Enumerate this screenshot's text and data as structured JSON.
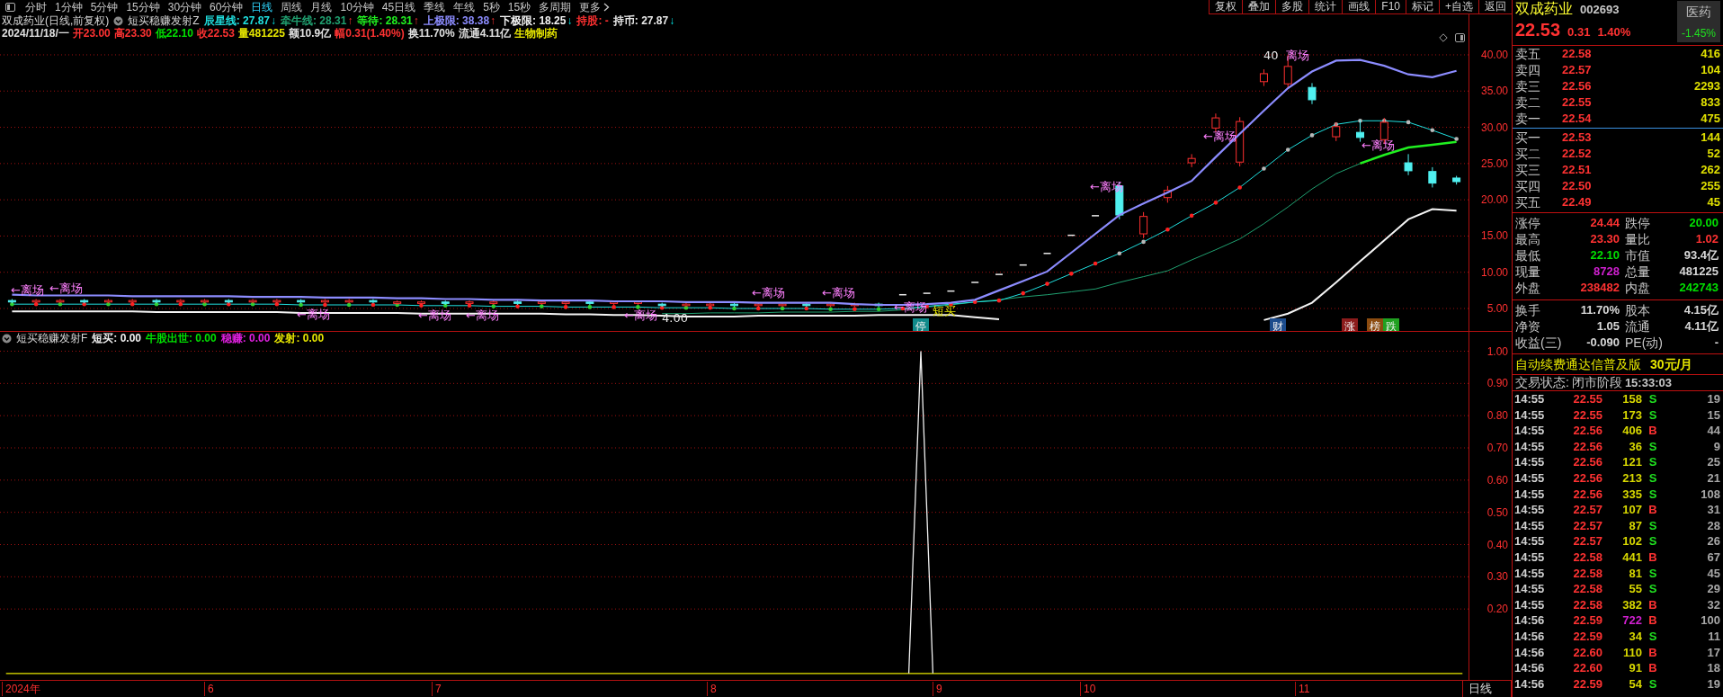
{
  "menu": {
    "periods": [
      {
        "label": "分时",
        "selected": false
      },
      {
        "label": "1分钟",
        "selected": false
      },
      {
        "label": "5分钟",
        "selected": false
      },
      {
        "label": "15分钟",
        "selected": false
      },
      {
        "label": "30分钟",
        "selected": false
      },
      {
        "label": "60分钟",
        "selected": false
      },
      {
        "label": "日线",
        "selected": true
      },
      {
        "label": "周线",
        "selected": false
      },
      {
        "label": "月线",
        "selected": false
      },
      {
        "label": "10分钟",
        "selected": false
      },
      {
        "label": "45日线",
        "selected": false
      },
      {
        "label": "季线",
        "selected": false
      },
      {
        "label": "年线",
        "selected": false
      },
      {
        "label": "5秒",
        "selected": false
      },
      {
        "label": "15秒",
        "selected": false
      },
      {
        "label": "多周期",
        "selected": false
      }
    ],
    "more": "更多",
    "tools": [
      "复权",
      "叠加",
      "多股",
      "统计",
      "画线",
      "F10",
      "标记",
      "+自选",
      "返回"
    ]
  },
  "chart": {
    "title": "双成药业(日线,前复权)",
    "indicator": "短买稳赚发射Z",
    "separator": ":",
    "lines": [
      {
        "value": "27.87",
        "arrow": "↓",
        "rising": false
      },
      {
        "value": "28.31",
        "arrow": "↑",
        "rising": true
      },
      {
        "value": "28.31",
        "arrow": "↑",
        "rising": true
      },
      {
        "value": "38.38",
        "arrow": "↑",
        "rising": true
      },
      {
        "value": "18.25",
        "arrow": "↓",
        "rising": false
      }
    ],
    "status": [
      {
        "label": "持股",
        "value": "-",
        "color": "#ff3030"
      },
      {
        "label": "持币",
        "value": "27.87",
        "arrow": "↓",
        "rising": false,
        "color": "#e8e8e8"
      }
    ],
    "quote": [
      {
        "text": "2024/11/18/一",
        "color": "#e0e0e0"
      },
      {
        "text": "开23.00",
        "color": "#ff3232"
      },
      {
        "text": "高23.30",
        "color": "#ff3232"
      },
      {
        "text": "低22.10",
        "color": "#00e000"
      },
      {
        "text": "收22.53",
        "color": "#ff3232"
      },
      {
        "text": "量481225",
        "color": "#e8e800"
      },
      {
        "text": "额10.9亿",
        "color": "#e0e0e0"
      },
      {
        "text": "幅0.31(1.40%)",
        "color": "#ff3232"
      },
      {
        "text": "换11.70%",
        "color": "#e0e0e0"
      },
      {
        "text": "流通4.11亿",
        "color": "#e0e0e0"
      },
      {
        "text": "生物制药",
        "color": "#e8e800"
      }
    ],
    "chart_data": {
      "type": "candlestick",
      "grid": true,
      "ylim": [
        1.9,
        45.58
      ],
      "yticks": [
        {
          "value": 40,
          "label": "40.00"
        },
        {
          "value": 35,
          "label": "35.00"
        },
        {
          "value": 30,
          "label": "30.00"
        },
        {
          "value": 25,
          "label": "25.00"
        },
        {
          "value": 20,
          "label": "20.00"
        },
        {
          "value": 15,
          "label": "15.00"
        },
        {
          "value": 10,
          "label": "10.00"
        },
        {
          "value": 5,
          "label": "5.00"
        }
      ],
      "categories": [
        null,
        null,
        null,
        null,
        null,
        null,
        null,
        null,
        null,
        null,
        null,
        null,
        null,
        null,
        null,
        null,
        null,
        null,
        null,
        null,
        null,
        null,
        null,
        null,
        null,
        null,
        null,
        null,
        null,
        null,
        null,
        null,
        null,
        null,
        null,
        null,
        null,
        null,
        null,
        null,
        null,
        null,
        null,
        null,
        null,
        null,
        null,
        null,
        null,
        null,
        null,
        null,
        null,
        null,
        null,
        null,
        null,
        null,
        null,
        null,
        null
      ],
      "ohlc": [
        [
          6.1,
          6.3,
          5.7,
          5.9
        ],
        [
          5.9,
          6.3,
          5.7,
          6.1
        ],
        [
          5.9,
          6.3,
          5.7,
          6.1
        ],
        [
          6.1,
          6.3,
          5.7,
          5.9
        ],
        [
          5.9,
          6.3,
          5.7,
          6.1
        ],
        [
          5.9,
          6.3,
          5.7,
          6.1
        ],
        [
          6.1,
          6.3,
          5.7,
          5.9
        ],
        [
          5.9,
          6.3,
          5.7,
          6.1
        ],
        [
          5.9,
          6.3,
          5.7,
          6.1
        ],
        [
          6.1,
          6.3,
          5.7,
          5.9
        ],
        [
          5.9,
          6.3,
          5.7,
          6.1
        ],
        [
          5.9,
          6.3,
          5.7,
          6.1
        ],
        [
          6.1,
          6.3,
          5.7,
          5.9
        ],
        [
          5.9,
          6.3,
          5.7,
          6.1
        ],
        [
          5.9,
          6.3,
          5.7,
          6.1
        ],
        [
          6.1,
          6.3,
          5.7,
          5.9
        ],
        [
          5.7,
          6.1,
          5.5,
          5.9
        ],
        [
          5.7,
          6.1,
          5.5,
          5.9
        ],
        [
          5.9,
          6.1,
          5.5,
          5.7
        ],
        [
          5.7,
          6.1,
          5.5,
          5.9
        ],
        [
          5.7,
          6.1,
          5.5,
          5.9
        ],
        [
          5.9,
          6.1,
          5.5,
          5.7
        ],
        [
          5.7,
          6.1,
          5.5,
          5.9
        ],
        [
          5.7,
          6.1,
          5.5,
          5.9
        ],
        [
          5.9,
          6.1,
          5.5,
          5.7
        ],
        [
          5.7,
          6.1,
          5.5,
          5.9
        ],
        [
          5.7,
          6.1,
          5.5,
          5.9
        ],
        [
          5.6,
          5.8,
          5.2,
          5.4
        ],
        [
          5.4,
          5.8,
          5.2,
          5.6
        ],
        [
          5.4,
          5.8,
          5.2,
          5.6
        ],
        [
          5.6,
          5.8,
          5.2,
          5.4
        ],
        [
          5.4,
          5.8,
          5.2,
          5.6
        ],
        [
          5.4,
          5.8,
          5.2,
          5.6
        ],
        [
          5.6,
          5.8,
          5.2,
          5.4
        ],
        [
          5.4,
          5.8,
          5.2,
          5.6
        ],
        [
          5.4,
          5.8,
          5.2,
          5.6
        ],
        [
          5.6,
          5.8,
          5.2,
          5.4
        ],
        [
          6.9,
          6.9,
          6.9,
          6.9
        ],
        [
          7.1,
          7.1,
          7.1,
          7.1
        ],
        [
          7.4,
          7.4,
          7.4,
          7.4
        ],
        [
          8.6,
          8.6,
          8.6,
          8.6
        ],
        [
          9.7,
          9.7,
          9.7,
          9.7
        ],
        [
          11.0,
          11.0,
          11.0,
          11.0
        ],
        [
          12.6,
          12.6,
          12.6,
          12.6
        ],
        [
          15.1,
          15.1,
          15.1,
          15.1
        ],
        [
          17.8,
          17.8,
          17.8,
          17.8
        ],
        [
          21.9,
          22.5,
          17.3,
          17.9
        ],
        [
          15.3,
          18.3,
          14.7,
          17.7
        ],
        [
          20.3,
          21.9,
          19.6,
          21.3
        ],
        [
          25.1,
          26.3,
          24.5,
          25.7
        ],
        [
          29.9,
          31.9,
          29.3,
          31.3
        ],
        [
          25.2,
          31.4,
          24.6,
          30.8
        ],
        [
          36.3,
          38.0,
          35.7,
          37.4
        ],
        [
          36.0,
          40.0,
          35.4,
          38.4
        ],
        [
          35.5,
          36.1,
          33.2,
          33.8
        ],
        [
          28.7,
          30.7,
          28.1,
          30.1
        ],
        [
          29.3,
          31.0,
          28.0,
          28.6
        ],
        [
          28.3,
          31.3,
          27.7,
          30.7
        ],
        [
          25.1,
          26.3,
          23.4,
          24.0
        ],
        [
          23.9,
          24.5,
          21.7,
          22.3
        ],
        [
          23.0,
          23.3,
          22.1,
          22.5
        ]
      ],
      "series": [
        {
          "name": "辰星线",
          "type": "line",
          "color": "#20e0e0",
          "values": [
            5.6,
            5.6,
            5.6,
            5.6,
            5.6,
            5.6,
            5.6,
            5.6,
            5.6,
            5.6,
            5.6,
            5.6,
            5.5,
            5.5,
            5.5,
            5.5,
            5.5,
            5.4,
            5.4,
            5.4,
            5.3,
            5.3,
            5.3,
            5.2,
            5.2,
            5.2,
            5.2,
            5.1,
            5.1,
            5.1,
            5.0,
            5.0,
            5.0,
            5.0,
            4.9,
            4.9,
            4.9,
            5.0,
            5.3,
            5.6,
            5.9,
            6.1,
            7.1,
            8.4,
            9.8,
            11.2,
            12.6,
            14.2,
            15.9,
            17.8,
            19.6,
            21.7,
            24.3,
            26.9,
            28.9,
            30.4,
            30.9,
            30.9,
            30.7,
            29.6,
            28.4
          ]
        },
        {
          "name": "牵牛线",
          "type": "line",
          "color": "#20a070",
          "values": [
            null,
            null,
            null,
            null,
            null,
            null,
            null,
            null,
            null,
            null,
            null,
            null,
            null,
            null,
            null,
            null,
            null,
            null,
            null,
            null,
            null,
            null,
            null,
            null,
            null,
            null,
            null,
            4.3,
            4.3,
            4.4,
            4.4,
            4.4,
            4.5,
            4.5,
            4.5,
            4.6,
            4.6,
            4.8,
            5.2,
            5.5,
            5.9,
            6.2,
            6.6,
            6.9,
            7.3,
            7.7,
            8.6,
            9.4,
            10.2,
            11.7,
            13.1,
            14.6,
            16.7,
            19.0,
            21.5,
            23.6,
            25.0,
            null,
            null,
            null,
            null
          ]
        },
        {
          "name": "等待",
          "type": "line",
          "color": "#20f020",
          "values": [
            null,
            null,
            null,
            null,
            null,
            null,
            null,
            null,
            null,
            null,
            null,
            null,
            null,
            null,
            null,
            null,
            null,
            null,
            null,
            null,
            null,
            null,
            null,
            null,
            null,
            null,
            null,
            null,
            null,
            null,
            null,
            null,
            null,
            null,
            null,
            null,
            null,
            null,
            null,
            null,
            null,
            null,
            null,
            null,
            null,
            null,
            null,
            null,
            null,
            null,
            null,
            null,
            null,
            null,
            null,
            null,
            25.0,
            26.2,
            27.2,
            27.6,
            28.0
          ]
        },
        {
          "name": "上极限",
          "type": "line",
          "color": "#8c8cff",
          "values": [
            6.9,
            6.8,
            6.8,
            6.8,
            6.8,
            6.7,
            6.7,
            6.7,
            6.7,
            6.7,
            6.6,
            6.6,
            6.6,
            6.5,
            6.5,
            6.5,
            6.4,
            6.4,
            6.3,
            6.3,
            6.2,
            6.2,
            6.1,
            6.1,
            6.1,
            6.0,
            6.0,
            6.0,
            5.9,
            5.9,
            5.9,
            5.8,
            5.8,
            5.8,
            5.8,
            5.6,
            5.5,
            5.5,
            5.6,
            5.8,
            6.2,
            7.5,
            8.8,
            10.1,
            12.7,
            15.3,
            17.9,
            19.5,
            21.0,
            22.6,
            25.9,
            29.1,
            32.3,
            35.4,
            37.7,
            39.2,
            39.3,
            38.5,
            37.3,
            36.9,
            37.8
          ]
        },
        {
          "name": "下极限",
          "type": "line",
          "color": "#f4f4f4",
          "values": [
            4.6,
            4.6,
            4.6,
            4.6,
            4.6,
            4.6,
            4.5,
            4.5,
            4.5,
            4.5,
            4.5,
            4.5,
            4.4,
            4.4,
            4.4,
            4.4,
            4.4,
            4.3,
            4.3,
            4.3,
            4.3,
            4.3,
            4.3,
            4.2,
            4.2,
            4.1,
            4.1,
            4.0,
            3.9,
            3.9,
            3.9,
            4.0,
            4.0,
            4.0,
            4.0,
            4.0,
            4.1,
            4.1,
            4.1,
            4.1,
            3.8,
            3.5,
            null,
            null,
            null,
            null,
            null,
            null,
            null,
            null,
            null,
            null,
            3.4,
            4.3,
            5.8,
            8.6,
            11.5,
            14.4,
            17.3,
            18.7,
            18.5
          ]
        }
      ]
    },
    "labels": [
      {
        "text": "←离场",
        "kind": "exit"
      },
      {
        "text": "←离场",
        "kind": "exit"
      },
      {
        "text": "←离场",
        "kind": "exit"
      },
      {
        "text": "←离场",
        "kind": "exit"
      },
      {
        "text": "←离场",
        "kind": "exit"
      },
      {
        "text": "←离场",
        "kind": "exit"
      },
      {
        "text": "←离场",
        "kind": "exit"
      },
      {
        "text": "←离场",
        "kind": "exit"
      },
      {
        "text": "←离场",
        "kind": "exit"
      },
      {
        "text": "短买",
        "kind": "buy"
      },
      {
        "text": "4.00",
        "kind": "price"
      },
      {
        "text": "←离场",
        "kind": "exit"
      },
      {
        "text": "←离场",
        "kind": "exit"
      },
      {
        "text": "40",
        "kind": "price"
      },
      {
        "text": "离场",
        "kind": "exit"
      },
      {
        "text": "←离场",
        "kind": "exit"
      },
      {
        "text": "停",
        "kind": "badge",
        "color": "#108a8a"
      },
      {
        "text": "财",
        "kind": "badge",
        "color": "#1c4c8c"
      },
      {
        "text": "涨",
        "kind": "badge",
        "color": "#8c1c1c"
      },
      {
        "text": "榜",
        "kind": "badge",
        "color": "#8c4c10"
      },
      {
        "text": "跌",
        "kind": "badge",
        "color": "#20a020"
      }
    ]
  },
  "indicator_panel": {
    "indicator": "短买稳赚发射F",
    "separator": ":",
    "values": [
      {
        "kind": "series",
        "value": "0.00"
      },
      {
        "kind": "plain",
        "label": "牛股出世",
        "color": "#00e000",
        "value": "0.00"
      },
      {
        "kind": "plain",
        "label": "稳赚",
        "color": "#e020e0",
        "value": "0.00"
      },
      {
        "kind": "series",
        "value": "0.00"
      }
    ],
    "chart_data": {
      "type": "line",
      "grid": true,
      "ylim": [
        -0.02,
        1.06
      ],
      "yticks": [
        {
          "value": 1,
          "label": "1.00"
        },
        {
          "value": 0.9,
          "label": "0.90"
        },
        {
          "value": 0.8,
          "label": "0.80"
        },
        {
          "value": 0.7,
          "label": "0.70"
        },
        {
          "value": 0.6,
          "label": "0.60"
        },
        {
          "value": 0.5,
          "label": "0.50"
        },
        {
          "value": 0.4,
          "label": "0.40"
        },
        {
          "value": 0.3,
          "label": "0.30"
        },
        {
          "value": 0.2,
          "label": "0.20"
        }
      ],
      "categories": [
        null,
        null,
        null,
        null,
        null,
        null,
        null,
        null,
        null,
        null,
        null,
        null,
        null,
        null,
        null,
        null,
        null,
        null,
        null,
        null,
        null,
        null,
        null,
        null,
        null,
        null,
        null,
        null,
        null,
        null,
        null,
        null,
        null,
        null,
        null,
        null,
        null,
        null,
        null,
        null,
        null,
        null,
        null,
        null,
        null,
        null,
        null,
        null,
        null,
        null,
        null,
        null,
        null,
        null,
        null,
        null,
        null,
        null,
        null,
        null,
        null,
        null,
        null,
        null,
        null,
        null,
        null,
        null,
        null,
        null,
        null,
        null,
        null,
        null,
        null,
        null,
        null,
        null,
        null,
        null,
        null,
        null,
        null,
        null,
        null,
        null,
        null,
        null,
        null,
        null,
        null,
        null,
        null,
        null,
        null,
        null,
        null,
        null,
        null,
        null,
        null,
        null,
        null,
        null,
        null,
        null,
        null,
        null,
        null,
        null,
        null,
        null,
        null,
        null,
        null,
        null,
        null,
        null,
        null,
        null,
        null,
        null
      ],
      "series": [
        {
          "name": "短买",
          "color": "#f0f0f0",
          "values": [
            null,
            null,
            null,
            null,
            null,
            null,
            null,
            null,
            null,
            null,
            null,
            null,
            null,
            null,
            null,
            null,
            null,
            null,
            null,
            null,
            null,
            null,
            null,
            null,
            null,
            null,
            null,
            null,
            null,
            null,
            null,
            null,
            null,
            null,
            null,
            null,
            null,
            null,
            null,
            null,
            null,
            null,
            null,
            null,
            null,
            null,
            null,
            null,
            null,
            null,
            null,
            null,
            null,
            null,
            null,
            null,
            null,
            null,
            null,
            null,
            null,
            null,
            null,
            null,
            null,
            null,
            null,
            null,
            null,
            null,
            null,
            null,
            null,
            null,
            null,
            0,
            1,
            0,
            null,
            null,
            null,
            null,
            null,
            null,
            null,
            null,
            null,
            null,
            null,
            null,
            null,
            null,
            null,
            null,
            null,
            null,
            null,
            null,
            null,
            null,
            null,
            null,
            null,
            null,
            null,
            null,
            null,
            null,
            null,
            null,
            null,
            null,
            null,
            null,
            null,
            null,
            null,
            null,
            null,
            null,
            null,
            null
          ]
        },
        {
          "name": "发射",
          "color": "#e8e800",
          "values": [
            0,
            0,
            0,
            0,
            0,
            0,
            0,
            0,
            0,
            0,
            0,
            0,
            0,
            0,
            0,
            0,
            0,
            0,
            0,
            0,
            0,
            0,
            0,
            0,
            0,
            0,
            0,
            0,
            0,
            0,
            0,
            0,
            0,
            0,
            0,
            0,
            0,
            0,
            0,
            0,
            0,
            0,
            0,
            0,
            0,
            0,
            0,
            0,
            0,
            0,
            0,
            0,
            0,
            0,
            0,
            0,
            0,
            0,
            0,
            0,
            0,
            0,
            0,
            0,
            0,
            0,
            0,
            0,
            0,
            0,
            0,
            0,
            0,
            0,
            0,
            0,
            0,
            0,
            0,
            0,
            0,
            0,
            0,
            0,
            0,
            0,
            0,
            0,
            0,
            0,
            0,
            0,
            0,
            0,
            0,
            0,
            0,
            0,
            0,
            0,
            0,
            0,
            0,
            0,
            0,
            0,
            0,
            0,
            0,
            0,
            0,
            0,
            0,
            0,
            0,
            0,
            0,
            0,
            0,
            0,
            0,
            0
          ]
        }
      ]
    }
  },
  "x_axis": {
    "labels": [
      "2024年",
      "6",
      "7",
      "8",
      "9",
      "10",
      "11"
    ],
    "period": "日线"
  },
  "quote_panel": {
    "name": "双成药业",
    "code": "002693",
    "price": "22.53",
    "change": "0.31",
    "change_pct": "1.40%",
    "sector": {
      "name": "医药",
      "change": "-1.45%"
    },
    "asks": [
      {
        "label": "卖五",
        "price": "22.58",
        "volume": "416"
      },
      {
        "label": "卖四",
        "price": "22.57",
        "volume": "104"
      },
      {
        "label": "卖三",
        "price": "22.56",
        "volume": "2293"
      },
      {
        "label": "卖二",
        "price": "22.55",
        "volume": "833"
      },
      {
        "label": "卖一",
        "price": "22.54",
        "volume": "475"
      }
    ],
    "bids": [
      {
        "label": "买一",
        "price": "22.53",
        "volume": "144"
      },
      {
        "label": "买二",
        "price": "22.52",
        "volume": "52"
      },
      {
        "label": "买三",
        "price": "22.51",
        "volume": "262"
      },
      {
        "label": "买四",
        "price": "22.50",
        "volume": "255"
      },
      {
        "label": "买五",
        "price": "22.49",
        "volume": "45"
      }
    ],
    "stats": [
      {
        "label": "涨停",
        "value": "24.44",
        "color": "#ff3232"
      },
      {
        "label": "跌停",
        "value": "20.00",
        "color": "#00e000"
      },
      {
        "label": "最高",
        "value": "23.30",
        "color": "#ff3232"
      },
      {
        "label": "量比",
        "value": "1.02",
        "color": "#ff3232"
      },
      {
        "label": "最低",
        "value": "22.10",
        "color": "#00e000"
      },
      {
        "label": "市值",
        "value": "93.4亿",
        "color": "#d8d8d8"
      },
      {
        "label": "现量",
        "value": "8728",
        "color": "#d020d0"
      },
      {
        "label": "总量",
        "value": "481225",
        "color": "#d8d8d8"
      },
      {
        "label": "外盘",
        "value": "238482",
        "color": "#ff3232"
      },
      {
        "label": "内盘",
        "value": "242743",
        "color": "#00e000"
      }
    ],
    "fundamentals": [
      {
        "label": "换手",
        "value": "11.70%"
      },
      {
        "label": "股本",
        "value": "4.15亿"
      },
      {
        "label": "净资",
        "value": "1.05"
      },
      {
        "label": "流通",
        "value": "4.11亿"
      },
      {
        "label": "收益(三)",
        "value": "-0.090"
      },
      {
        "label": "PE(动)",
        "value": "-"
      }
    ],
    "promo": {
      "text": "自动续费通达信普及版",
      "price": "30元/月"
    },
    "trade_status": {
      "label": "交易状态:",
      "value": "闭市阶段",
      "time": "15:33:03"
    },
    "ticks": [
      {
        "time": "14:55",
        "price": "22.55",
        "volume": "158",
        "side": "S",
        "buy": false,
        "big": false,
        "count": "19"
      },
      {
        "time": "14:55",
        "price": "22.55",
        "volume": "173",
        "side": "S",
        "buy": false,
        "big": false,
        "count": "15"
      },
      {
        "time": "14:55",
        "price": "22.56",
        "volume": "406",
        "side": "B",
        "buy": true,
        "big": false,
        "count": "44"
      },
      {
        "time": "14:55",
        "price": "22.56",
        "volume": "36",
        "side": "S",
        "buy": false,
        "big": false,
        "count": "9"
      },
      {
        "time": "14:55",
        "price": "22.56",
        "volume": "121",
        "side": "S",
        "buy": false,
        "big": false,
        "count": "25"
      },
      {
        "time": "14:55",
        "price": "22.56",
        "volume": "213",
        "side": "S",
        "buy": false,
        "big": false,
        "count": "21"
      },
      {
        "time": "14:55",
        "price": "22.56",
        "volume": "335",
        "side": "S",
        "buy": false,
        "big": false,
        "count": "108"
      },
      {
        "time": "14:55",
        "price": "22.57",
        "volume": "107",
        "side": "B",
        "buy": true,
        "big": false,
        "count": "31"
      },
      {
        "time": "14:55",
        "price": "22.57",
        "volume": "87",
        "side": "S",
        "buy": false,
        "big": false,
        "count": "28"
      },
      {
        "time": "14:55",
        "price": "22.57",
        "volume": "102",
        "side": "S",
        "buy": false,
        "big": false,
        "count": "26"
      },
      {
        "time": "14:55",
        "price": "22.58",
        "volume": "441",
        "side": "B",
        "buy": true,
        "big": false,
        "count": "67"
      },
      {
        "time": "14:55",
        "price": "22.58",
        "volume": "81",
        "side": "S",
        "buy": false,
        "big": false,
        "count": "45"
      },
      {
        "time": "14:55",
        "price": "22.58",
        "volume": "55",
        "side": "S",
        "buy": false,
        "big": false,
        "count": "29"
      },
      {
        "time": "14:55",
        "price": "22.58",
        "volume": "382",
        "side": "B",
        "buy": true,
        "big": false,
        "count": "32"
      },
      {
        "time": "14:56",
        "price": "22.59",
        "volume": "722",
        "side": "B",
        "buy": true,
        "big": true,
        "count": "100"
      },
      {
        "time": "14:56",
        "price": "22.59",
        "volume": "34",
        "side": "S",
        "buy": false,
        "big": false,
        "count": "11"
      },
      {
        "time": "14:56",
        "price": "22.60",
        "volume": "110",
        "side": "B",
        "buy": true,
        "big": false,
        "count": "17"
      },
      {
        "time": "14:56",
        "price": "22.60",
        "volume": "91",
        "side": "B",
        "buy": true,
        "big": false,
        "count": "18"
      },
      {
        "time": "14:56",
        "price": "22.59",
        "volume": "54",
        "side": "S",
        "buy": false,
        "big": false,
        "count": "19"
      }
    ]
  }
}
